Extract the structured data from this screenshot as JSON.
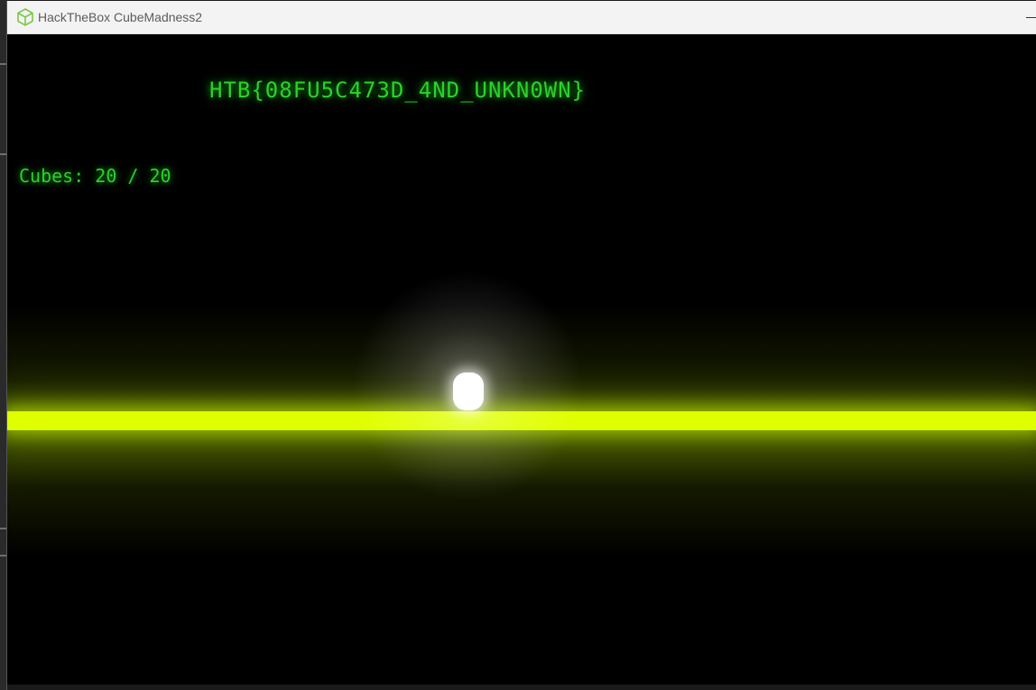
{
  "window": {
    "title": "HackTheBox CubeMadness2",
    "icon": "cube-icon"
  },
  "hud": {
    "flag": "HTB{08FU5C473D_4ND_UNKN0WN}",
    "cubes_label": "Cubes:",
    "cubes_collected": 20,
    "cubes_total": 20,
    "cubes_text": "Cubes: 20 / 20"
  },
  "colors": {
    "hud_text": "#2bd12b",
    "floor": "#dfff00",
    "player": "#ffffff",
    "background": "#000000",
    "icon": "#7ac943"
  }
}
